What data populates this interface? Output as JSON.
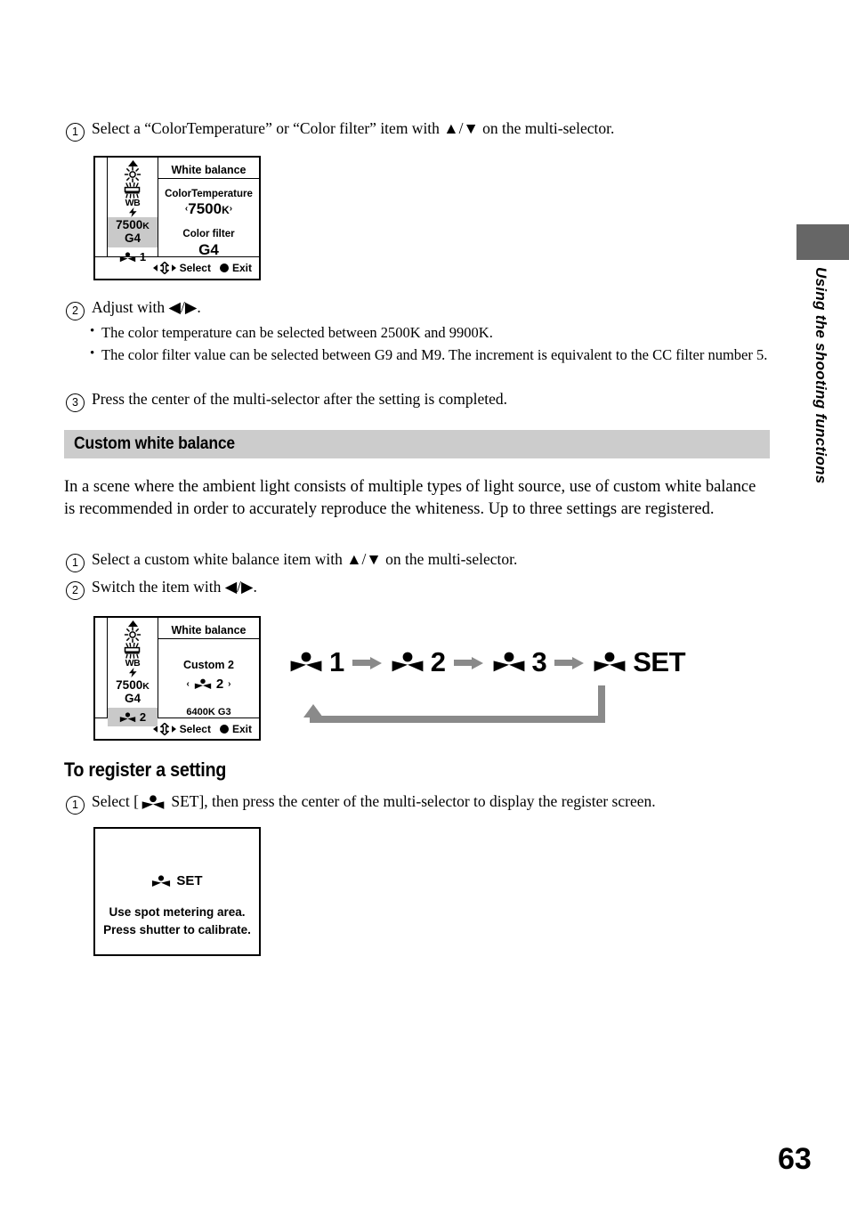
{
  "page": {
    "number": "63",
    "side_tab_label": "Using the shooting functions",
    "side_tab_color": "#666666",
    "section_bar_color": "#cccccc"
  },
  "steps_top": {
    "step1": {
      "num": "①",
      "text": "Select a “ColorTemperature” or “Color filter” item with ▲/▼ on the multi-selector."
    },
    "step2": {
      "num": "②",
      "text": "Adjust with ◀/▶."
    },
    "bullets": [
      "The color temperature can be selected between 2500K and 9900K.",
      "The color filter value can be selected between G9 and M9. The increment is equivalent to the CC filter number 5."
    ],
    "step3": {
      "num": "③",
      "text": "Press the center of the multi-selector after the setting is completed."
    }
  },
  "lcd_colortemp": {
    "icon_column": {
      "up_arrow": "▲",
      "icons": [
        "daylight-icon",
        "fluorescent-icon",
        "wb-flash-icon"
      ],
      "wb_label": "WB",
      "color_temp": "7500",
      "color_temp_unit": "K",
      "color_filter": "G4",
      "color_temp_selected": true,
      "custom_number": "1",
      "custom_selected": false
    },
    "title": "White balance",
    "field1_label": "ColorTemperature",
    "field1_value": "7500",
    "field1_unit": "K",
    "field1_left_arrow": "‹",
    "field1_right_arrow": "›",
    "field2_label": "Color filter",
    "field2_value": "G4",
    "bottom_select": "Select",
    "bottom_exit": "Exit"
  },
  "section_custom_wb": {
    "heading": "Custom white balance",
    "paragraph": "In a scene where the ambient light consists of multiple types of light source, use of custom white balance is recommended in order to accurately reproduce the whiteness. Up to three settings are registered.",
    "step1": {
      "num": "①",
      "text": "Select a custom white balance item with ▲/▼ on the multi-selector."
    },
    "step2": {
      "num": "②",
      "text": "Switch the item with ◀/▶."
    }
  },
  "lcd_custom": {
    "icon_column": {
      "up_arrow": "▲",
      "wb_label": "WB",
      "color_temp": "7500",
      "color_temp_unit": "K",
      "color_filter": "G4",
      "color_temp_selected": false,
      "custom_number": "2",
      "custom_selected": true
    },
    "title": "White balance",
    "field1_label": "Custom 2",
    "field1_value": "2",
    "field1_left_arrow": "‹",
    "field1_right_arrow": "›",
    "field2_value": "6400K G3",
    "bottom_select": "Select",
    "bottom_exit": "Exit"
  },
  "flow_diagram": {
    "nodes": [
      "1",
      "2",
      "3",
      "SET"
    ],
    "arrow_color": "#8a8a8a",
    "loop_back": true
  },
  "section_register": {
    "heading": "To register a setting",
    "step1_num": "①",
    "step1_text_before": "Select [",
    "step1_text_after": " SET], then press the center of the multi-selector to display the register screen."
  },
  "lcd_register": {
    "set_label": "SET",
    "line1": "Use spot metering area.",
    "line2": "Press shutter to calibrate."
  }
}
